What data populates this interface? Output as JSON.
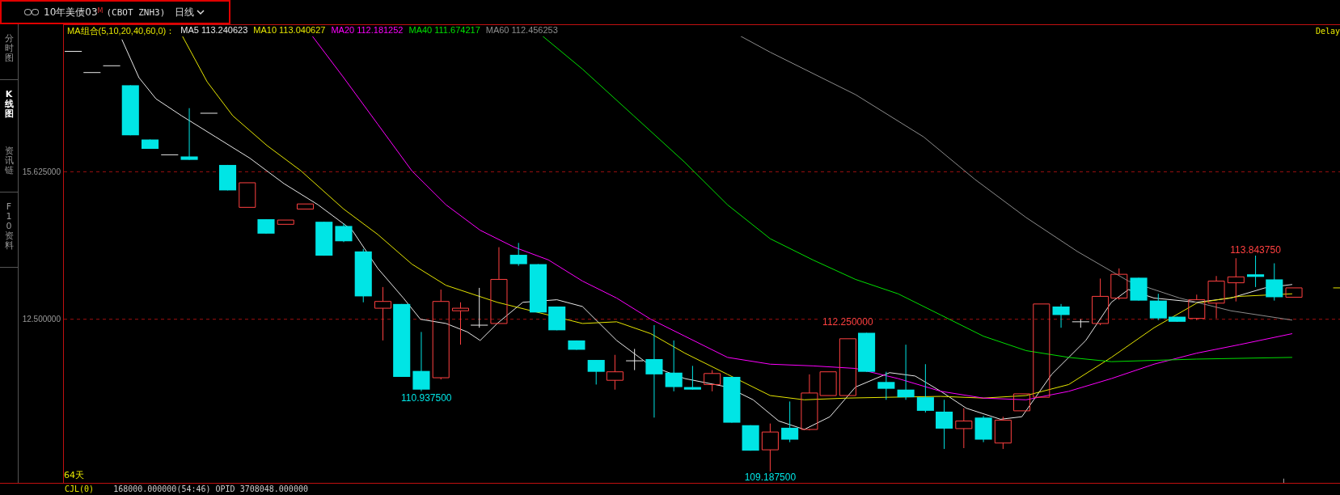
{
  "header": {
    "contract": "10年美债03",
    "market_mark": "M",
    "code": "(CBOT ZNH3)",
    "period": "日线"
  },
  "tabs": [
    {
      "label": "分时图",
      "selected": false
    },
    {
      "label": "K线图",
      "selected": true
    },
    {
      "label": "资讯链",
      "selected": false
    },
    {
      "label": "F10资料",
      "selected": false
    }
  ],
  "legend": [
    {
      "text": "MA组合(5,10,20,40,60,0)：",
      "color": "#e6e600"
    },
    {
      "text": "MA5 113.240623",
      "color": "#e8e8e8"
    },
    {
      "text": "MA10 113.040627",
      "color": "#e6e600"
    },
    {
      "text": "MA20 112.181252",
      "color": "#ff00ff"
    },
    {
      "text": "MA40 111.674217",
      "color": "#00e000"
    },
    {
      "text": "MA60 112.456253",
      "color": "#8c8c8c"
    }
  ],
  "delay": "Delay",
  "price_axis": [
    "15.625000",
    "12.500000"
  ],
  "annotations": [
    {
      "text": "110.937500",
      "color": "#00e5e5"
    },
    {
      "text": "112.250000",
      "color": "#ff4040"
    },
    {
      "text": "113.843750",
      "color": "#ff4040"
    },
    {
      "text": "109.187500",
      "color": "#00e5e5"
    }
  ],
  "bar_count": "64天",
  "footer": {
    "indicator": "CJL(0)",
    "values": "168000.000000(54:46)  OPID 3708048.000000"
  }
}
